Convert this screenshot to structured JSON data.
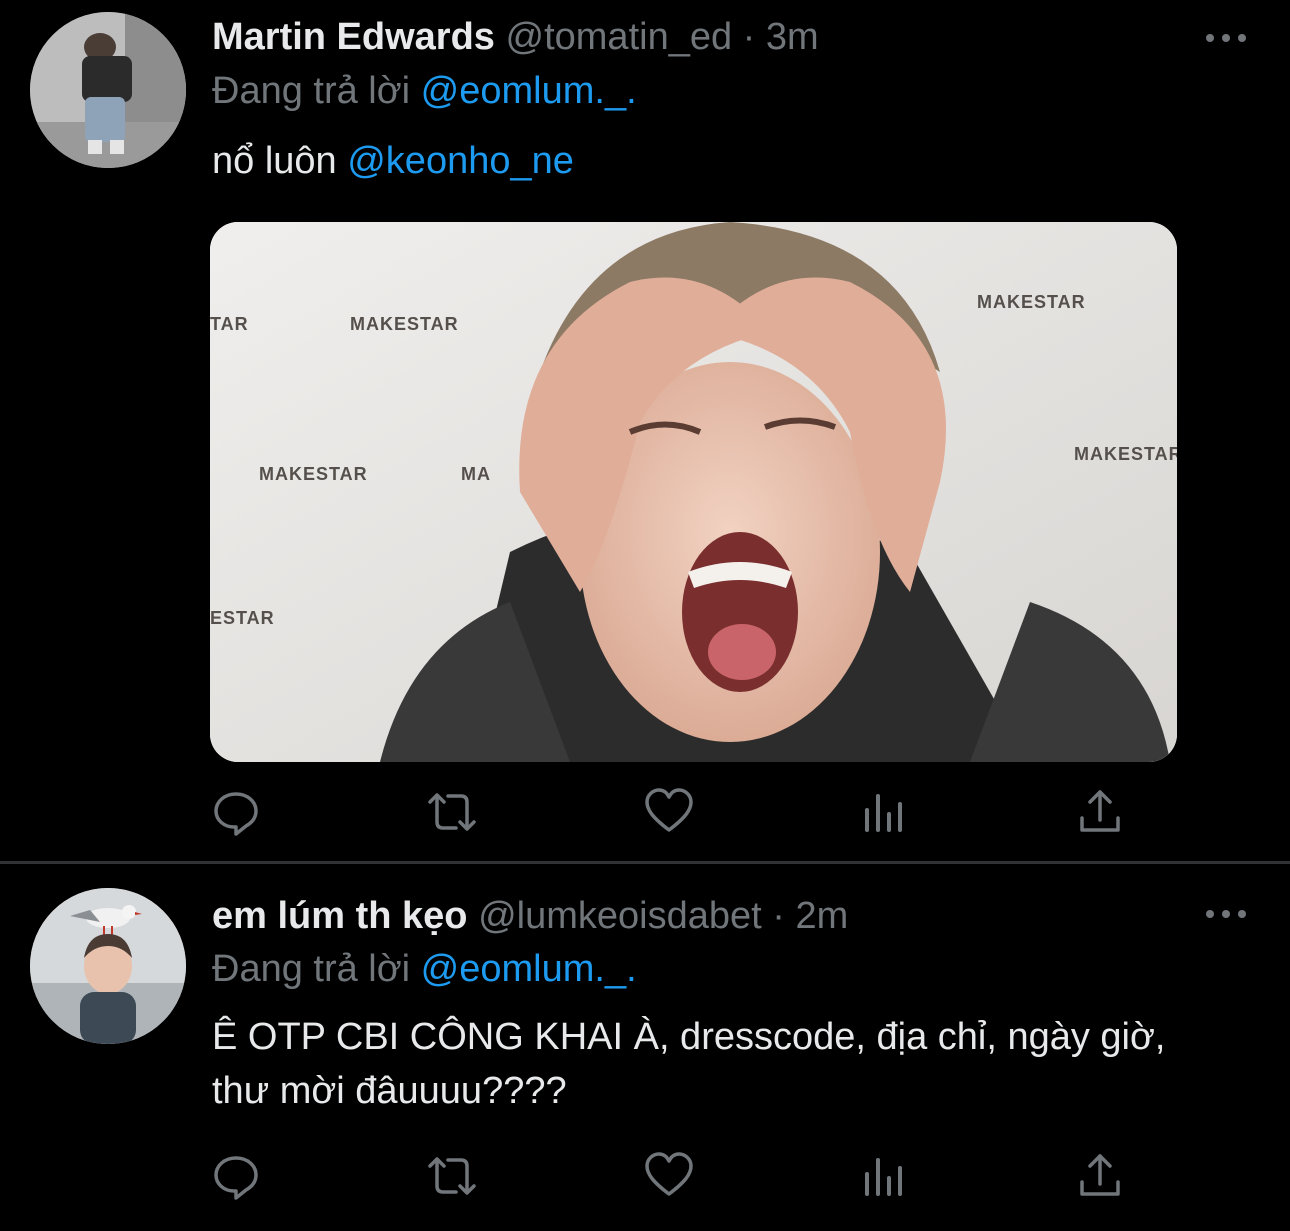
{
  "colors": {
    "background": "#000000",
    "text": "#e7e9ea",
    "muted": "#71767b",
    "link": "#1d9bf0",
    "divider": "#2f3336"
  },
  "tweets": [
    {
      "name": "Martin Edwards",
      "handle": "@tomatin_ed",
      "separator": "·",
      "time": "3m",
      "reply_prefix": "Đang trả lời",
      "reply_to": "@eomlum._.",
      "text": "nổ luôn",
      "text_mention": "@keonho_ne",
      "media": {
        "type": "photo",
        "watermarks": [
          "TAR",
          "MAKESTAR",
          "MAKESTAR",
          "MAKESTAR",
          "MAKESTAR",
          "MA",
          "ESTAR"
        ]
      },
      "actions": [
        "reply-icon",
        "retweet-icon",
        "like-icon",
        "analytics-icon",
        "share-icon"
      ]
    },
    {
      "name": "em lúm th kẹo",
      "handle": "@lumkeoisdabet",
      "separator": "·",
      "time": "2m",
      "reply_prefix": "Đang trả lời",
      "reply_to": "@eomlum._.",
      "text": "Ê OTP CBI CÔNG KHAI À, dresscode, địa chỉ, ngày giờ, thư mời đâuuuu????",
      "actions": [
        "reply-icon",
        "retweet-icon",
        "like-icon",
        "analytics-icon",
        "share-icon"
      ]
    }
  ]
}
